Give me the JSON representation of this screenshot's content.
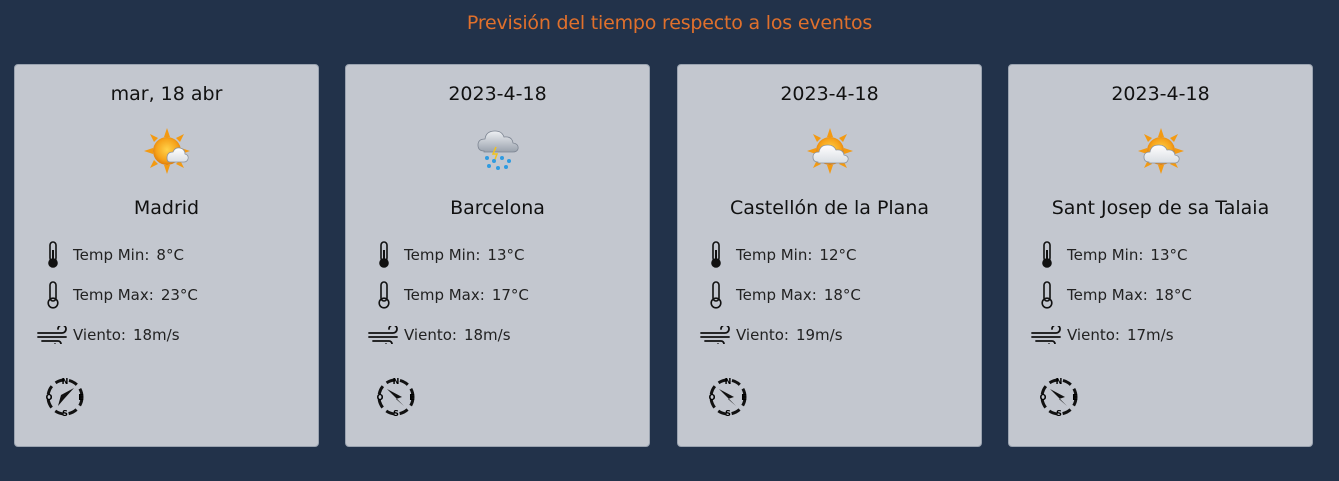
{
  "page": {
    "title": "Previsión del tiempo respecto a los eventos"
  },
  "colors": {
    "background": "#22324a",
    "card": "#c3c7cf",
    "title": "#e0702c"
  },
  "labels": {
    "temp_min": "Temp Min:",
    "temp_max": "Temp Max:",
    "wind": "Viento:"
  },
  "cards": [
    {
      "date": "mar, 18 abr",
      "city": "Madrid",
      "icon": "sun-with-cloud-icon",
      "temp_min": "8°C",
      "temp_max": "23°C",
      "wind": "18m/s"
    },
    {
      "date": "2023-4-18",
      "city": "Barcelona",
      "icon": "rain-cloud-icon",
      "temp_min": "13°C",
      "temp_max": "17°C",
      "wind": "18m/s"
    },
    {
      "date": "2023-4-18",
      "city": "Castellón de la Plana",
      "icon": "partly-cloudy-icon",
      "temp_min": "12°C",
      "temp_max": "18°C",
      "wind": "19m/s"
    },
    {
      "date": "2023-4-18",
      "city": "Sant Josep de sa Talaia",
      "icon": "partly-cloudy-icon",
      "temp_min": "13°C",
      "temp_max": "18°C",
      "wind": "17m/s"
    }
  ]
}
